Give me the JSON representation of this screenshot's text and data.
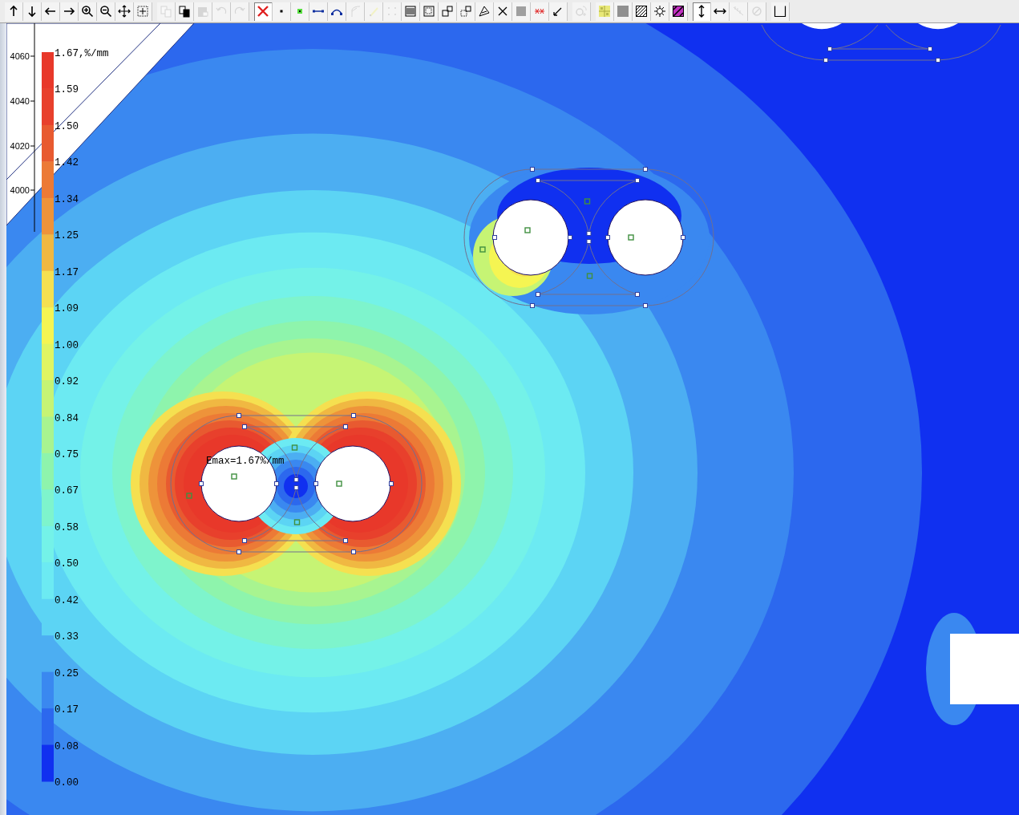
{
  "toolbar": {
    "groups": [
      [
        {
          "kind": "arrow-up",
          "disabled": false,
          "pressed": false
        },
        {
          "kind": "arrow-down",
          "disabled": false,
          "pressed": false
        },
        {
          "kind": "arrow-left",
          "disabled": false,
          "pressed": false
        },
        {
          "kind": "arrow-right",
          "disabled": false,
          "pressed": false
        },
        {
          "kind": "zoom-in",
          "disabled": false,
          "pressed": false
        },
        {
          "kind": "zoom-out",
          "disabled": false,
          "pressed": false
        },
        {
          "kind": "pan",
          "disabled": false,
          "pressed": false
        },
        {
          "kind": "zoom-window",
          "disabled": false,
          "pressed": false
        }
      ],
      [
        {
          "kind": "copy",
          "disabled": true,
          "pressed": false
        },
        {
          "kind": "copy-special",
          "disabled": false,
          "pressed": false
        },
        {
          "kind": "paste",
          "disabled": true,
          "pressed": false
        },
        {
          "kind": "undo",
          "disabled": true,
          "pressed": false
        },
        {
          "kind": "redo",
          "disabled": true,
          "pressed": false
        }
      ],
      [
        {
          "kind": "delete",
          "disabled": false,
          "pressed": true
        },
        {
          "kind": "vertex",
          "disabled": false,
          "pressed": false
        },
        {
          "kind": "vertex-label",
          "disabled": false,
          "pressed": false
        },
        {
          "kind": "edge",
          "disabled": false,
          "pressed": false
        },
        {
          "kind": "arc",
          "disabled": false,
          "pressed": false
        },
        {
          "kind": "branch",
          "disabled": true,
          "pressed": false
        },
        {
          "kind": "marker",
          "disabled": true,
          "pressed": false
        },
        {
          "kind": "dots",
          "disabled": true,
          "pressed": false
        },
        {
          "kind": "lines",
          "disabled": false,
          "pressed": false
        },
        {
          "kind": "box",
          "disabled": false,
          "pressed": false
        },
        {
          "kind": "squares",
          "disabled": false,
          "pressed": false
        },
        {
          "kind": "squares-dotted",
          "disabled": false,
          "pressed": false
        },
        {
          "kind": "pen",
          "disabled": false,
          "pressed": false
        },
        {
          "kind": "cross",
          "disabled": false,
          "pressed": false
        },
        {
          "kind": "dot-fill",
          "disabled": false,
          "pressed": false
        },
        {
          "kind": "red-dashes",
          "disabled": false,
          "pressed": false
        },
        {
          "kind": "pointer",
          "disabled": false,
          "pressed": false
        }
      ],
      [
        {
          "kind": "refresh",
          "disabled": true,
          "pressed": false
        }
      ],
      [
        {
          "kind": "yellow-grid",
          "disabled": false,
          "pressed": false
        },
        {
          "kind": "grey-fill",
          "disabled": false,
          "pressed": false
        },
        {
          "kind": "hatch",
          "disabled": false,
          "pressed": false
        },
        {
          "kind": "sun",
          "disabled": false,
          "pressed": false
        },
        {
          "kind": "magenta-hatch",
          "disabled": false,
          "pressed": false
        }
      ],
      [
        {
          "kind": "vertical",
          "disabled": false,
          "pressed": true
        },
        {
          "kind": "horizontal",
          "disabled": false,
          "pressed": false
        },
        {
          "kind": "comb",
          "disabled": true,
          "pressed": false
        },
        {
          "kind": "no-entry",
          "disabled": true,
          "pressed": false
        }
      ],
      [
        {
          "kind": "bracket",
          "disabled": false,
          "pressed": false
        }
      ]
    ]
  },
  "axis": {
    "ticks": [
      "4060",
      "4040",
      "4020",
      "4000"
    ]
  },
  "legend": {
    "levels": [
      {
        "label": "1.67,%/mm",
        "color": "#e8382a"
      },
      {
        "label": "1.59",
        "color": "#e8402c"
      },
      {
        "label": "1.50",
        "color": "#e85a30"
      },
      {
        "label": "1.42",
        "color": "#ec7a36"
      },
      {
        "label": "1.34",
        "color": "#ee933a"
      },
      {
        "label": "1.25",
        "color": "#f0b842"
      },
      {
        "label": "1.17",
        "color": "#f5e050"
      },
      {
        "label": "1.09",
        "color": "#f5f552"
      },
      {
        "label": "1.00",
        "color": "#e0f562"
      },
      {
        "label": "0.92",
        "color": "#c6f474"
      },
      {
        "label": "0.84",
        "color": "#a8f490"
      },
      {
        "label": "0.75",
        "color": "#8ef4ac"
      },
      {
        "label": "0.67",
        "color": "#7ef4cc"
      },
      {
        "label": "0.58",
        "color": "#74f2e8"
      },
      {
        "label": "0.50",
        "color": "#6ceaf2"
      },
      {
        "label": "0.42",
        "color": "#5cd4f4"
      },
      {
        "label": "0.33",
        "color": "#4caef2"
      },
      {
        "label": "0.25",
        "color": "#3a88f0"
      },
      {
        "label": "0.17",
        "color": "#2c68ee"
      },
      {
        "label": "0.08",
        "color": "#1030f0"
      },
      {
        "label": "0.00"
      }
    ]
  },
  "annotation": {
    "text": "Emax=1.67%/mm"
  }
}
